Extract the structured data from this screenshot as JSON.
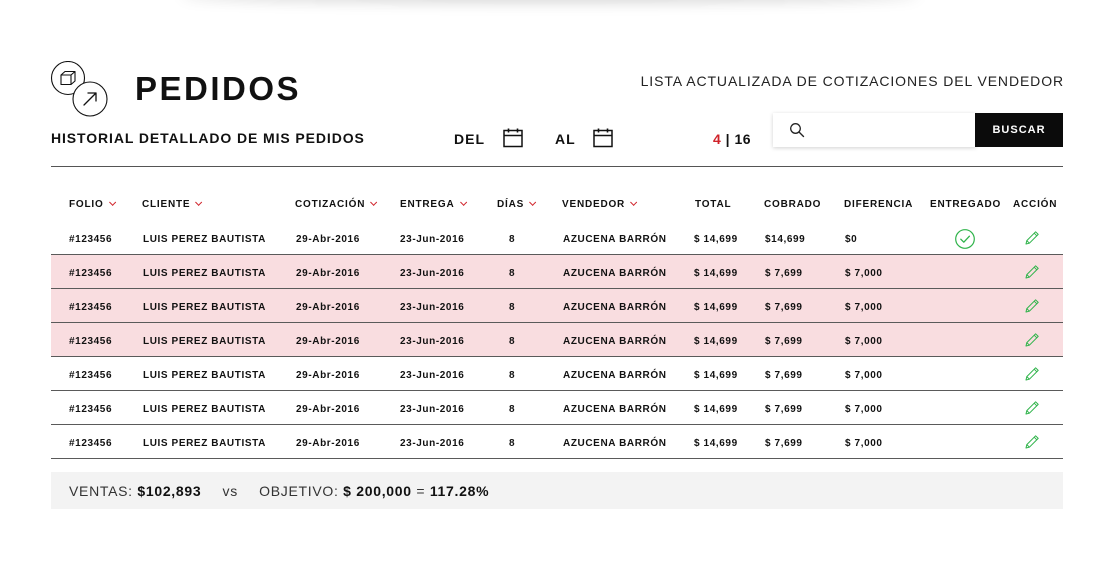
{
  "header": {
    "title": "PEDIDOS",
    "subtitle": "LISTA ACTUALIZADA DE COTIZACIONES DEL VENDEDOR",
    "section_title": "HISTORIAL DETALLADO DE MIS PEDIDOS"
  },
  "filters": {
    "del_label": "DEL",
    "al_label": "AL",
    "calendar_icon": "calendar-icon"
  },
  "pager": {
    "current": "4",
    "separator": " | ",
    "total": "16"
  },
  "search": {
    "placeholder": "",
    "value": "",
    "button_label": "BUSCAR",
    "icon": "search-icon"
  },
  "table": {
    "columns": [
      {
        "key": "folio",
        "label": "FOLIO",
        "sortable": true
      },
      {
        "key": "cliente",
        "label": "CLIENTE",
        "sortable": true
      },
      {
        "key": "cotizacion",
        "label": "COTIZACIÓN",
        "sortable": true
      },
      {
        "key": "entrega",
        "label": "ENTREGA",
        "sortable": true
      },
      {
        "key": "dias",
        "label": "DÍAS",
        "sortable": true
      },
      {
        "key": "vendedor",
        "label": "VENDEDOR",
        "sortable": true
      },
      {
        "key": "total",
        "label": "TOTAL",
        "sortable": false
      },
      {
        "key": "cobrado",
        "label": "COBRADO",
        "sortable": false
      },
      {
        "key": "diferencia",
        "label": "DIFERENCIA",
        "sortable": false
      },
      {
        "key": "entregado",
        "label": "ENTREGADO",
        "sortable": false
      },
      {
        "key": "accion",
        "label": "ACCIÓN",
        "sortable": false
      }
    ],
    "rows": [
      {
        "folio": "#123456",
        "cliente": "LUIS PEREZ BAUTISTA",
        "cotizacion": "29-Abr-2016",
        "entrega": "23-Jun-2016",
        "dias": "8",
        "vendedor": "AZUCENA BARRÓN",
        "total": "$ 14,699",
        "cobrado": "$14,699",
        "diferencia": "$0",
        "entregado": true,
        "highlight": false
      },
      {
        "folio": "#123456",
        "cliente": "LUIS PEREZ BAUTISTA",
        "cotizacion": "29-Abr-2016",
        "entrega": "23-Jun-2016",
        "dias": "8",
        "vendedor": "AZUCENA BARRÓN",
        "total": "$ 14,699",
        "cobrado": "$ 7,699",
        "diferencia": "$ 7,000",
        "entregado": false,
        "highlight": true
      },
      {
        "folio": "#123456",
        "cliente": "LUIS PEREZ BAUTISTA",
        "cotizacion": "29-Abr-2016",
        "entrega": "23-Jun-2016",
        "dias": "8",
        "vendedor": "AZUCENA BARRÓN",
        "total": "$ 14,699",
        "cobrado": "$ 7,699",
        "diferencia": "$ 7,000",
        "entregado": false,
        "highlight": true
      },
      {
        "folio": "#123456",
        "cliente": "LUIS PEREZ BAUTISTA",
        "cotizacion": "29-Abr-2016",
        "entrega": "23-Jun-2016",
        "dias": "8",
        "vendedor": "AZUCENA BARRÓN",
        "total": "$ 14,699",
        "cobrado": "$ 7,699",
        "diferencia": "$ 7,000",
        "entregado": false,
        "highlight": true
      },
      {
        "folio": "#123456",
        "cliente": "LUIS PEREZ BAUTISTA",
        "cotizacion": "29-Abr-2016",
        "entrega": "23-Jun-2016",
        "dias": "8",
        "vendedor": "AZUCENA BARRÓN",
        "total": "$ 14,699",
        "cobrado": "$ 7,699",
        "diferencia": "$ 7,000",
        "entregado": false,
        "highlight": false
      },
      {
        "folio": "#123456",
        "cliente": "LUIS PEREZ BAUTISTA",
        "cotizacion": "29-Abr-2016",
        "entrega": "23-Jun-2016",
        "dias": "8",
        "vendedor": "AZUCENA BARRÓN",
        "total": "$ 14,699",
        "cobrado": "$ 7,699",
        "diferencia": "$ 7,000",
        "entregado": false,
        "highlight": false
      },
      {
        "folio": "#123456",
        "cliente": "LUIS PEREZ BAUTISTA",
        "cotizacion": "29-Abr-2016",
        "entrega": "23-Jun-2016",
        "dias": "8",
        "vendedor": "AZUCENA BARRÓN",
        "total": "$ 14,699",
        "cobrado": "$ 7,699",
        "diferencia": "$ 7,000",
        "entregado": false,
        "highlight": false
      }
    ]
  },
  "summary": {
    "ventas_label": "VENTAS:",
    "ventas_value": "$102,893",
    "vs_label": "vs",
    "objetivo_label": "OBJETIVO:",
    "objetivo_value": "$ 200,000",
    "equals": "=",
    "percent": "117.28%"
  },
  "icons": {
    "logo": [
      "box-icon",
      "arrow-up-right-icon"
    ],
    "delivered": "check-circle-icon",
    "edit": "pencil-icon",
    "sort": "chevron-down-icon"
  },
  "colors": {
    "accent_red": "#d0232a",
    "highlight_row": "#f9dde0",
    "success_green": "#2fb34a",
    "button_black": "#0b0b0b",
    "summary_bg": "#f3f3f3"
  }
}
